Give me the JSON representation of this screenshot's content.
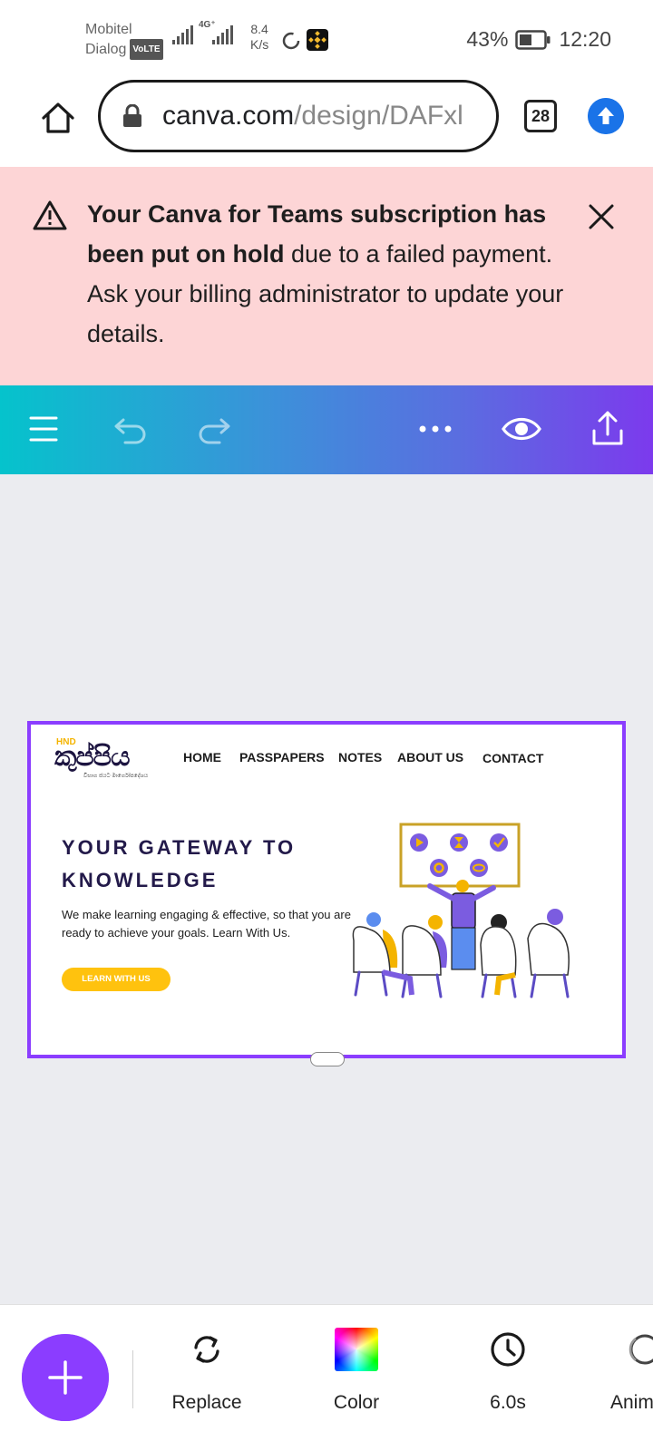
{
  "status_bar": {
    "carrier_1": "Mobitel",
    "carrier_2": "Dialog",
    "volte": "VoLTE",
    "network_type": "4G⁺",
    "speed_value": "8.4",
    "speed_unit": "K/s",
    "battery_percent": "43%",
    "time": "12:20"
  },
  "browser": {
    "url_domain": "canva.com",
    "url_path": "/design/DAFxl",
    "tab_count": "28",
    "icons": [
      "home-icon",
      "lock-icon",
      "upload-arrow-icon"
    ]
  },
  "banner": {
    "bold_text": "Your Canva for Teams subscription has been put on hold",
    "rest_text": " due to a failed payment. Ask your billing administrator to update your details."
  },
  "toolbar": {
    "icons": [
      "menu-icon",
      "undo-icon",
      "redo-icon",
      "more-icon",
      "preview-eye-icon",
      "share-icon"
    ]
  },
  "design": {
    "logo_hnd": "HND",
    "logo_main": "කුප්පිය",
    "logo_sub": "විභාග ජයට මාර්ගෝපදේශය",
    "nav": [
      "HOME",
      "PASSPAPERS",
      "NOTES",
      "ABOUT US",
      "CONTACT"
    ],
    "hero_title_line1": "YOUR GATEWAY TO",
    "hero_title_line2": "KNOWLEDGE",
    "hero_desc": "We make learning engaging & effective, so that you are ready to achieve your goals. Learn With Us.",
    "cta": "LEARN WITH US",
    "colors": {
      "accent": "#8b3dff",
      "cta": "#ffc20e",
      "title": "#231a4a"
    }
  },
  "bottom_toolbar": {
    "items": [
      {
        "label": "Replace",
        "icon": "replace-icon"
      },
      {
        "label": "Color",
        "icon": "color-swatch-icon"
      },
      {
        "label": "6.0s",
        "icon": "clock-icon"
      },
      {
        "label": "Anim",
        "icon": "animate-icon"
      }
    ]
  }
}
